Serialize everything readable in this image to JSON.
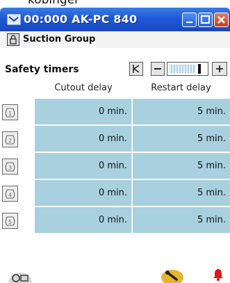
{
  "top_caption": "kobinger",
  "window": {
    "title": "00:000 AK-PC 840",
    "colors": {
      "titlebar": "#1f59d6",
      "close": "#c8401e"
    }
  },
  "header": {
    "group_label": "Suction Group"
  },
  "section": {
    "label": "Safety timers"
  },
  "table": {
    "columns": [
      "Cutout delay",
      "Restart delay"
    ],
    "rows": [
      {
        "index": "1",
        "cutout": "0 min.",
        "restart": "5 min."
      },
      {
        "index": "2",
        "cutout": "0 min.",
        "restart": "5 min."
      },
      {
        "index": "3",
        "cutout": "0 min.",
        "restart": "5 min."
      },
      {
        "index": "4",
        "cutout": "0 min.",
        "restart": "5 min."
      },
      {
        "index": "5",
        "cutout": "0 min.",
        "restart": "5 min."
      }
    ],
    "colors": {
      "cell": "#a8d0de"
    }
  },
  "icons": {
    "app": "app-icon",
    "lock": "lock-icon",
    "nav": [
      "first-icon",
      "prev-icon",
      "slider",
      "next-icon"
    ],
    "bottom": [
      "compressor-icon",
      "wrench-icon",
      "alarm-bell-icon"
    ]
  }
}
